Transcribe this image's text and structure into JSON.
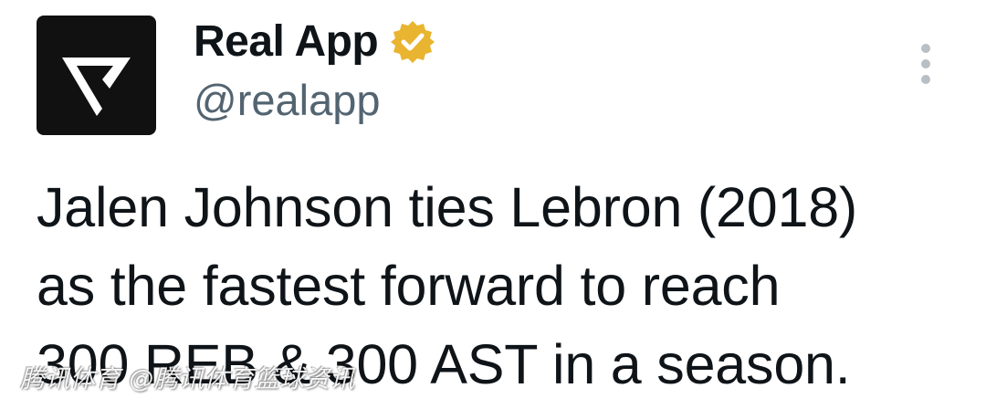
{
  "tweet": {
    "display_name": "Real App",
    "handle": "@realapp",
    "verified": true,
    "verified_badge_color": "#e9b42f",
    "text": "Jalen Johnson ties Lebron (2018)\nas the fastest forward to reach\n300 REB & 300 AST in a season."
  },
  "avatar": {
    "background": "#111111",
    "logo_color": "#ffffff"
  },
  "overflow_menu": {
    "icon": "more-vertical-icon"
  },
  "watermark": {
    "text": "腾讯体育 @腾讯体育篮球资讯"
  }
}
